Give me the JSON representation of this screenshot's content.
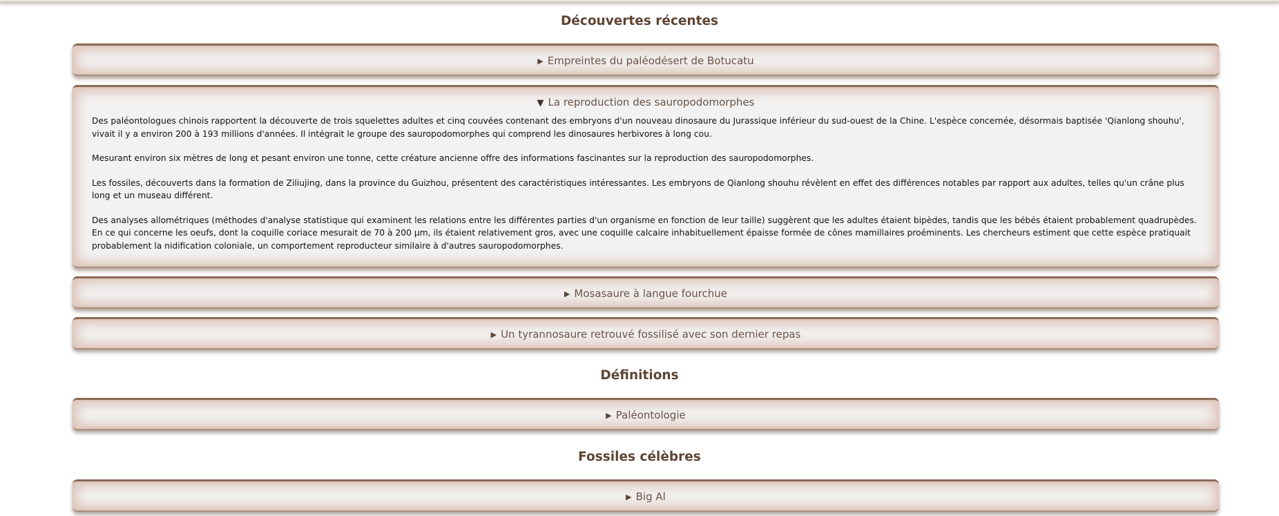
{
  "sections": [
    {
      "title": "Découvertes récentes",
      "items": [
        {
          "label": "Empreintes du paléodésert de Botucatu",
          "open": false
        },
        {
          "label": "La reproduction des sauropodomorphes",
          "open": true,
          "paragraphs": [
            "Des paléontologues chinois rapportent la découverte de trois squelettes adultes et cinq couvées contenant des embryons d'un nouveau dinosaure du Jurassique inférieur du sud-ouest de la Chine. L'espèce concernée, désormais baptisée 'Qianlong shouhu', vivait il y a environ 200 à 193 millions d'années. Il intégrait le groupe des sauropodomorphes qui comprend les dinosaures herbivores à long cou.",
            "Mesurant environ six mètres de long et pesant environ une tonne, cette créature ancienne offre des informations fascinantes sur la reproduction des sauropodomorphes.",
            "Les fossiles, découverts dans la formation de Ziliujing, dans la province du Guizhou, présentent des caractéristiques intéressantes. Les embryons de Qianlong shouhu révèlent en effet des différences notables par rapport aux adultes, telles qu'un crâne plus long et un museau différent.",
            "Des analyses allométriques (méthodes d'analyse statistique qui examinent les relations entre les différentes parties d'un organisme en fonction de leur taille) suggèrent que les adultes étaient bipèdes, tandis que les bébés étaient probablement quadrupèdes.",
            "En ce qui concerne les oeufs, dont la coquille coriace mesurait de 70 à 200 µm, ils étaient relativement gros, avec une coquille calcaire inhabituellement épaisse formée de cônes mamillaires proéminents. Les chercheurs estiment que cette espèce pratiquait probablement la nidification coloniale, un comportement reproducteur similaire à d'autres sauropodomorphes."
          ]
        },
        {
          "label": "Mosasaure à langue fourchue",
          "open": false
        },
        {
          "label": "Un tyrannosaure retrouvé fossilisé avec son dernier repas",
          "open": false
        }
      ]
    },
    {
      "title": "Définitions",
      "items": [
        {
          "label": "Paléontologie",
          "open": false
        }
      ]
    },
    {
      "title": "Fossiles célèbres",
      "items": [
        {
          "label": "Big Al",
          "open": false
        }
      ]
    }
  ],
  "icons": {
    "collapsed": "▶",
    "expanded": "▼"
  },
  "colors": {
    "heading": "#5e4432",
    "summary_text": "#6b5244",
    "panel_border": "#8a6a56",
    "panel_glow": "#dfc7bd"
  }
}
